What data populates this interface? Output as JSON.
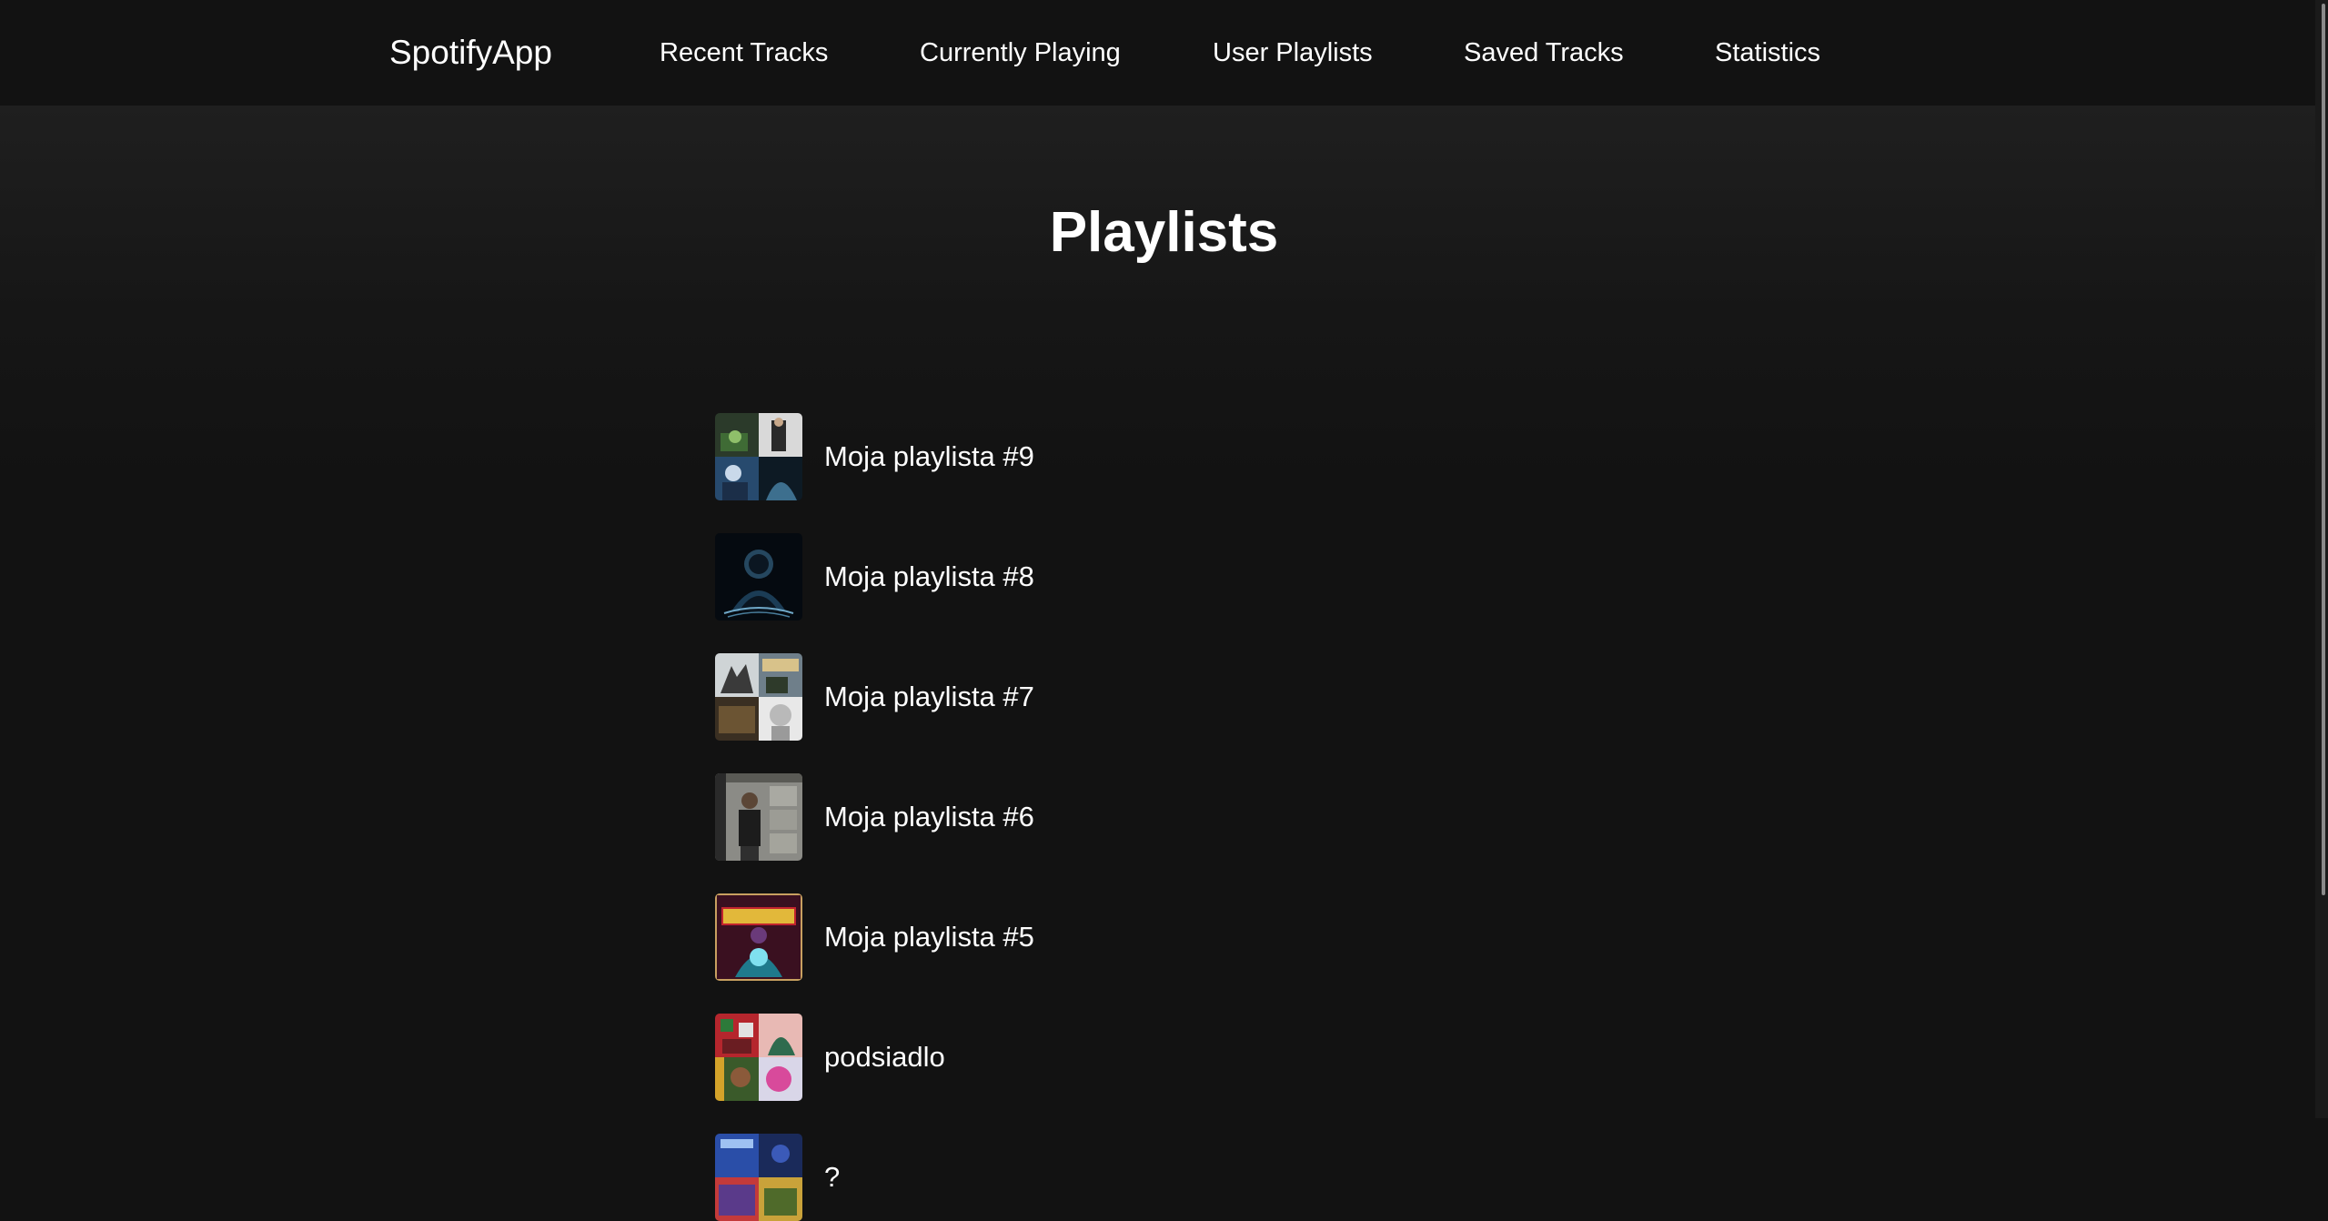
{
  "nav": {
    "brand": "SpotifyApp",
    "links": [
      {
        "label": "Recent Tracks"
      },
      {
        "label": "Currently Playing"
      },
      {
        "label": "User Playlists"
      },
      {
        "label": "Saved Tracks"
      },
      {
        "label": "Statistics"
      }
    ]
  },
  "main": {
    "title": "Playlists",
    "playlists": [
      {
        "name": "Moja playlista #9"
      },
      {
        "name": "Moja playlista #8"
      },
      {
        "name": "Moja playlista #7"
      },
      {
        "name": "Moja playlista #6"
      },
      {
        "name": "Moja playlista #5"
      },
      {
        "name": "podsiadlo"
      },
      {
        "name": "?"
      }
    ]
  }
}
